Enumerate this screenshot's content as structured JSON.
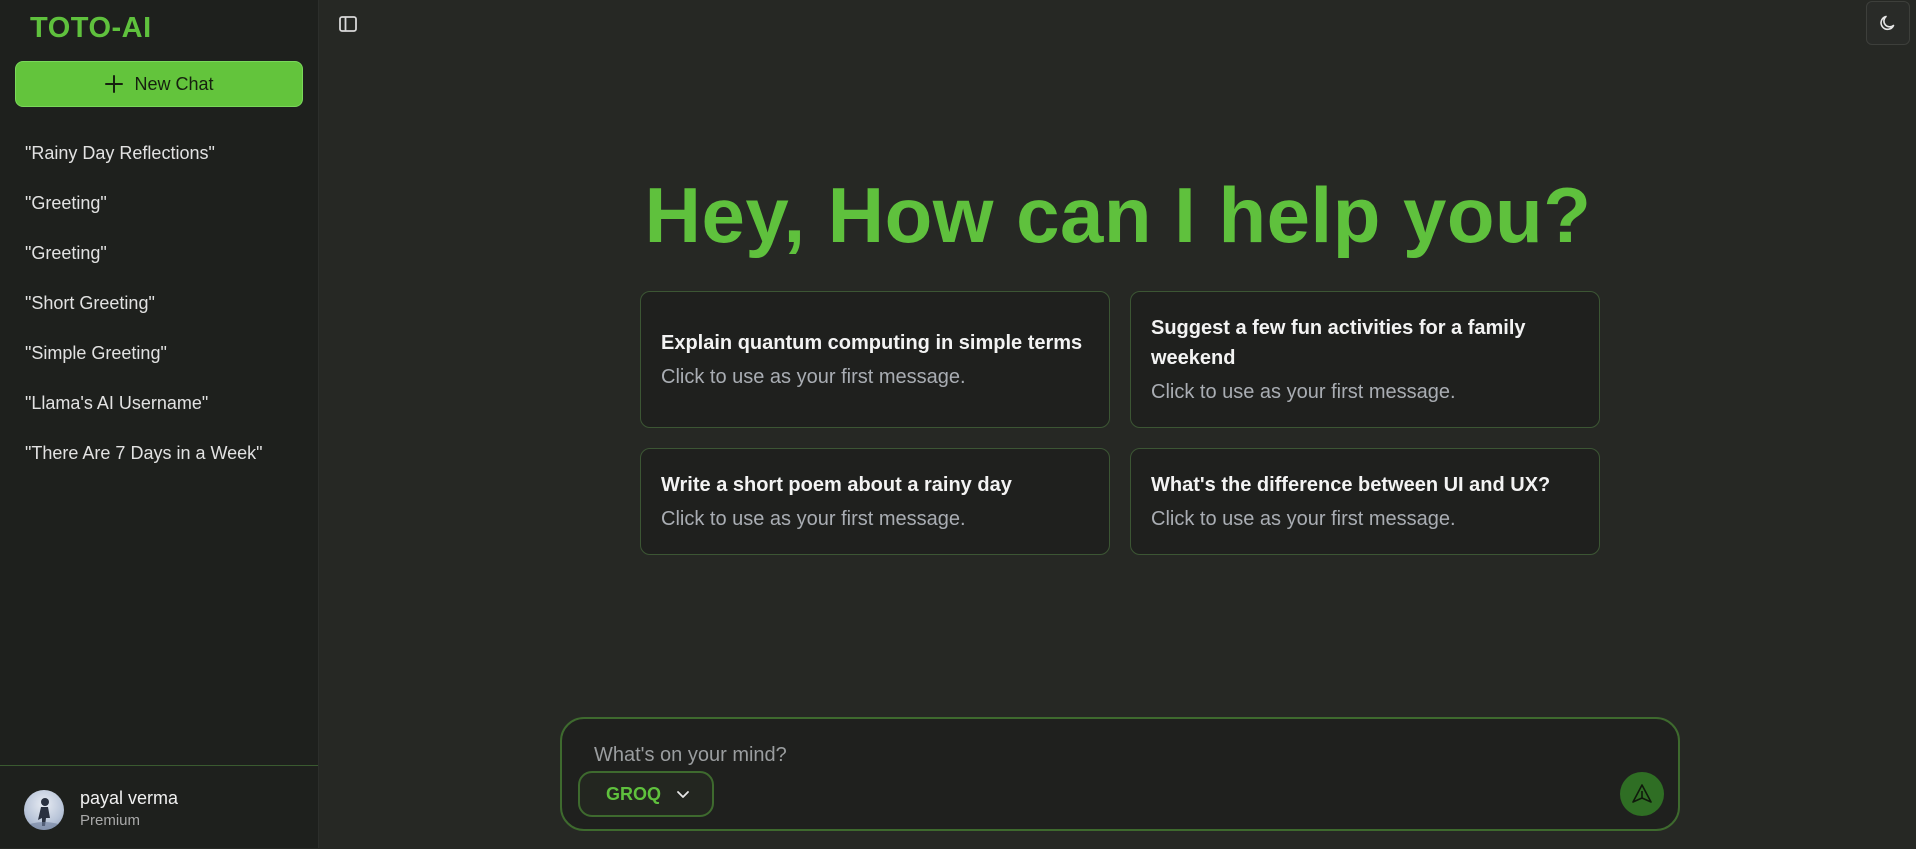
{
  "sidebar": {
    "brand": "TOTO-AI",
    "new_chat_label": "New Chat",
    "chats": [
      "\"Rainy Day Reflections\"",
      "\"Greeting\"",
      "\"Greeting\"",
      "\"Short Greeting\"",
      "\"Simple Greeting\"",
      "\"Llama's AI Username\"",
      "\"There Are 7 Days in a Week\""
    ],
    "user": {
      "name": "payal verma",
      "plan": "Premium"
    }
  },
  "main": {
    "headline": "Hey, How can I help you?",
    "suggestions": [
      {
        "title": "Explain quantum computing in simple terms",
        "subtitle": "Click to use as your first message."
      },
      {
        "title": "Suggest a few fun activities for a family weekend",
        "subtitle": "Click to use as your first message."
      },
      {
        "title": "Write a short poem about a rainy day",
        "subtitle": "Click to use as your first message."
      },
      {
        "title": "What's the difference between UI and UX?",
        "subtitle": "Click to use as your first message."
      }
    ]
  },
  "composer": {
    "placeholder": "What's on your mind?",
    "model": "GROQ"
  },
  "icons": {
    "toggle": "sidebar-toggle-icon",
    "theme": "moon-icon",
    "send": "send-icon",
    "chevron": "chevron-down-icon",
    "plus": "plus-icon"
  },
  "colors": {
    "accent": "#5fc13d",
    "new_chat_bg": "#63c43c",
    "background": "#262824",
    "sidebar_bg": "#1e201d",
    "card_bg": "#1f201e"
  }
}
